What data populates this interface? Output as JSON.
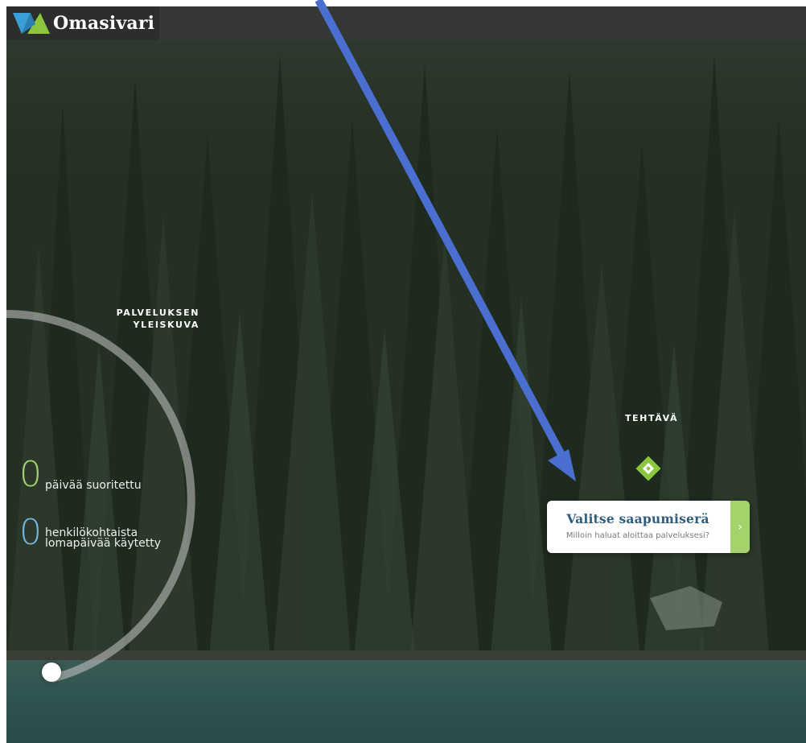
{
  "app": {
    "brand_name": "Omasivari"
  },
  "overview": {
    "title_line1": "PALVELUKSEN",
    "title_line2": "YLEISKUVA",
    "stats": [
      {
        "value": "0",
        "label": "päivää suoritettu",
        "color": "#a3d36a"
      },
      {
        "value": "0",
        "label_line1": "henkilökohtaista",
        "label_line2": "lomapäivää käytetty",
        "color": "#6fb6e3"
      }
    ]
  },
  "task": {
    "section_label": "TEHTÄVÄ",
    "card_title": "Valitse saapumiserä",
    "card_subtitle": "Milloin haluat aloittaa palveluksesi?",
    "next_icon": "chevron-right-icon",
    "accent": "#8cc63f"
  },
  "colors": {
    "topbar": "#353735",
    "annotation_arrow": "#4a6fd1"
  }
}
